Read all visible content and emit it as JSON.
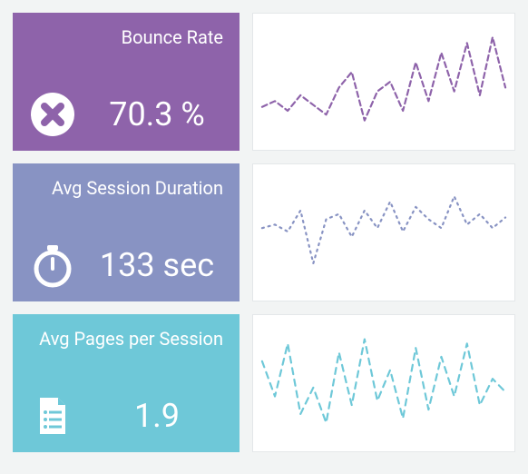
{
  "metrics": {
    "bounce": {
      "title": "Bounce Rate",
      "value": "70.3 %",
      "color": "#8e63aa",
      "stroke_dash": "6 4"
    },
    "session": {
      "title": "Avg Session Duration",
      "value": "133 sec",
      "color": "#8893c3",
      "stroke_dash": "2 5"
    },
    "pages": {
      "title": "Avg Pages per Session",
      "value": "1.9",
      "color": "#6ec8d8",
      "stroke_dash": "7 6"
    }
  },
  "chart_data": [
    {
      "type": "line",
      "title": "Bounce Rate trend",
      "series": [
        {
          "name": "Bounce Rate",
          "values": [
            62,
            65,
            60,
            68,
            63,
            58,
            72,
            80,
            55,
            70,
            75,
            60,
            85,
            65,
            90,
            70,
            95,
            68,
            98,
            72
          ]
        }
      ],
      "ylim": [
        50,
        100
      ],
      "xlabel": "",
      "ylabel": ""
    },
    {
      "type": "line",
      "title": "Avg Session Duration trend",
      "series": [
        {
          "name": "Avg Session Duration",
          "values": [
            130,
            132,
            128,
            140,
            110,
            135,
            138,
            125,
            140,
            130,
            145,
            128,
            142,
            135,
            130,
            148,
            132,
            138,
            130,
            136
          ]
        }
      ],
      "ylim": [
        100,
        155
      ],
      "xlabel": "",
      "ylabel": ""
    },
    {
      "type": "line",
      "title": "Avg Pages per Session trend",
      "series": [
        {
          "name": "Avg Pages per Session",
          "values": [
            2.4,
            1.6,
            2.8,
            1.2,
            1.8,
            1.0,
            2.6,
            1.4,
            2.9,
            1.5,
            2.2,
            1.1,
            2.7,
            1.3,
            2.5,
            1.6,
            2.8,
            1.4,
            2.0,
            1.7
          ]
        }
      ],
      "ylim": [
        0.8,
        3.0
      ],
      "xlabel": "",
      "ylabel": ""
    }
  ]
}
